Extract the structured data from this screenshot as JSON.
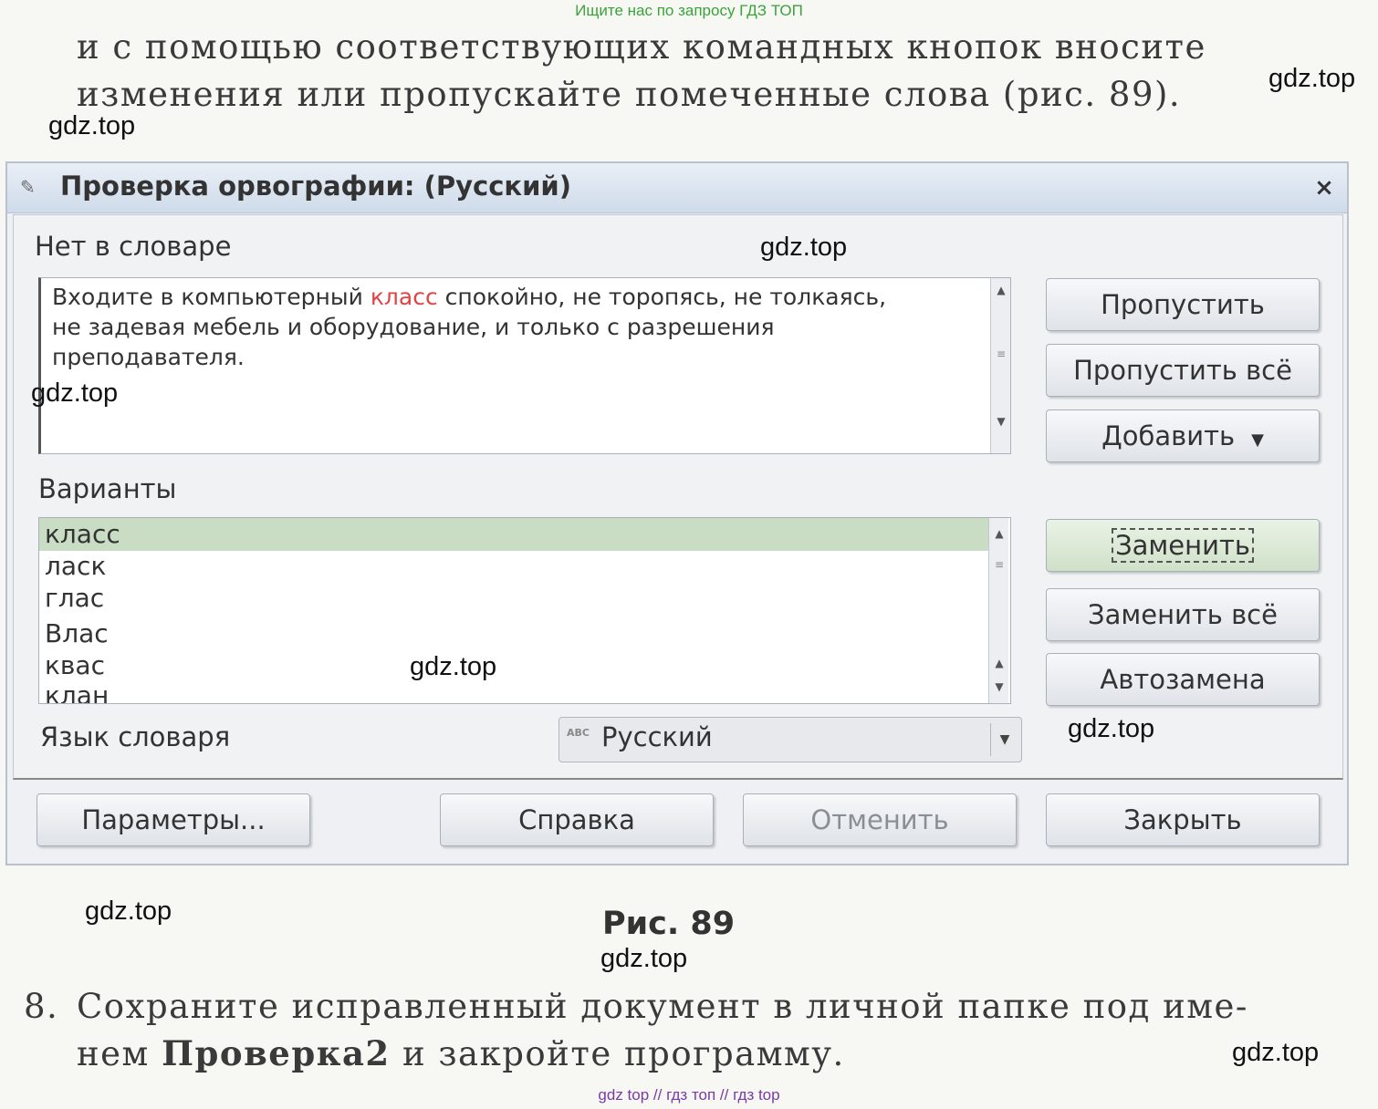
{
  "banner_top": "Ищите нас по запросу ГДЗ ТОП",
  "banner_bottom": "gdz top  //  гдз топ  //  гдз top",
  "book_text": {
    "line1": "и с помощью соответствующих командных кнопок вносите",
    "line2": "изменения или пропускайте помеченные слова (рис. 89).",
    "step8_num": "8.",
    "step8_line1": "Сохраните исправленный документ в личной папке под име-",
    "step8_line2_pre": "нем",
    "step8_line2_bold": "Проверка2",
    "step8_line2_post": "и закройте программу."
  },
  "figure_caption": "Рис. 89",
  "watermark": "gdz.top",
  "dialog": {
    "title": "Проверка орвографии: (Русский)",
    "close_label": "×",
    "not_in_dict_label": "Нет в словаре",
    "sentence": {
      "pre": "Входите в компьютерный ",
      "error_word": "класс",
      "post": " спокойно, не торопясь, не толкаясь,",
      "line2": "не задевая мебель и оборудование,  и только с разрешения",
      "line3": "преподавателя."
    },
    "suggestions_label": "Варианты",
    "suggestions": [
      "класс",
      "ласк",
      "глас",
      "Влас",
      "квас",
      "клан"
    ],
    "selected_suggestion": "класс",
    "language_label": "Язык словаря",
    "language_value": "Русский",
    "language_icon_text": "ABC",
    "buttons": {
      "skip": "Пропустить",
      "skip_all": "Пропустить всё",
      "add": "Добавить",
      "replace": "Заменить",
      "replace_all": "Заменить всё",
      "autocorrect": "Автозамена",
      "options": "Параметры...",
      "help": "Справка",
      "undo": "Отменить",
      "close": "Закрыть"
    },
    "icons": [
      "spellcheck-icon",
      "close-icon",
      "scroll-up-icon",
      "scroll-down-icon",
      "dropdown-caret-icon",
      "abc-language-icon"
    ],
    "colors": {
      "error_word": "#e04545",
      "selected_row": "#c9dcc4",
      "titlebar": "#cfdbea"
    }
  }
}
